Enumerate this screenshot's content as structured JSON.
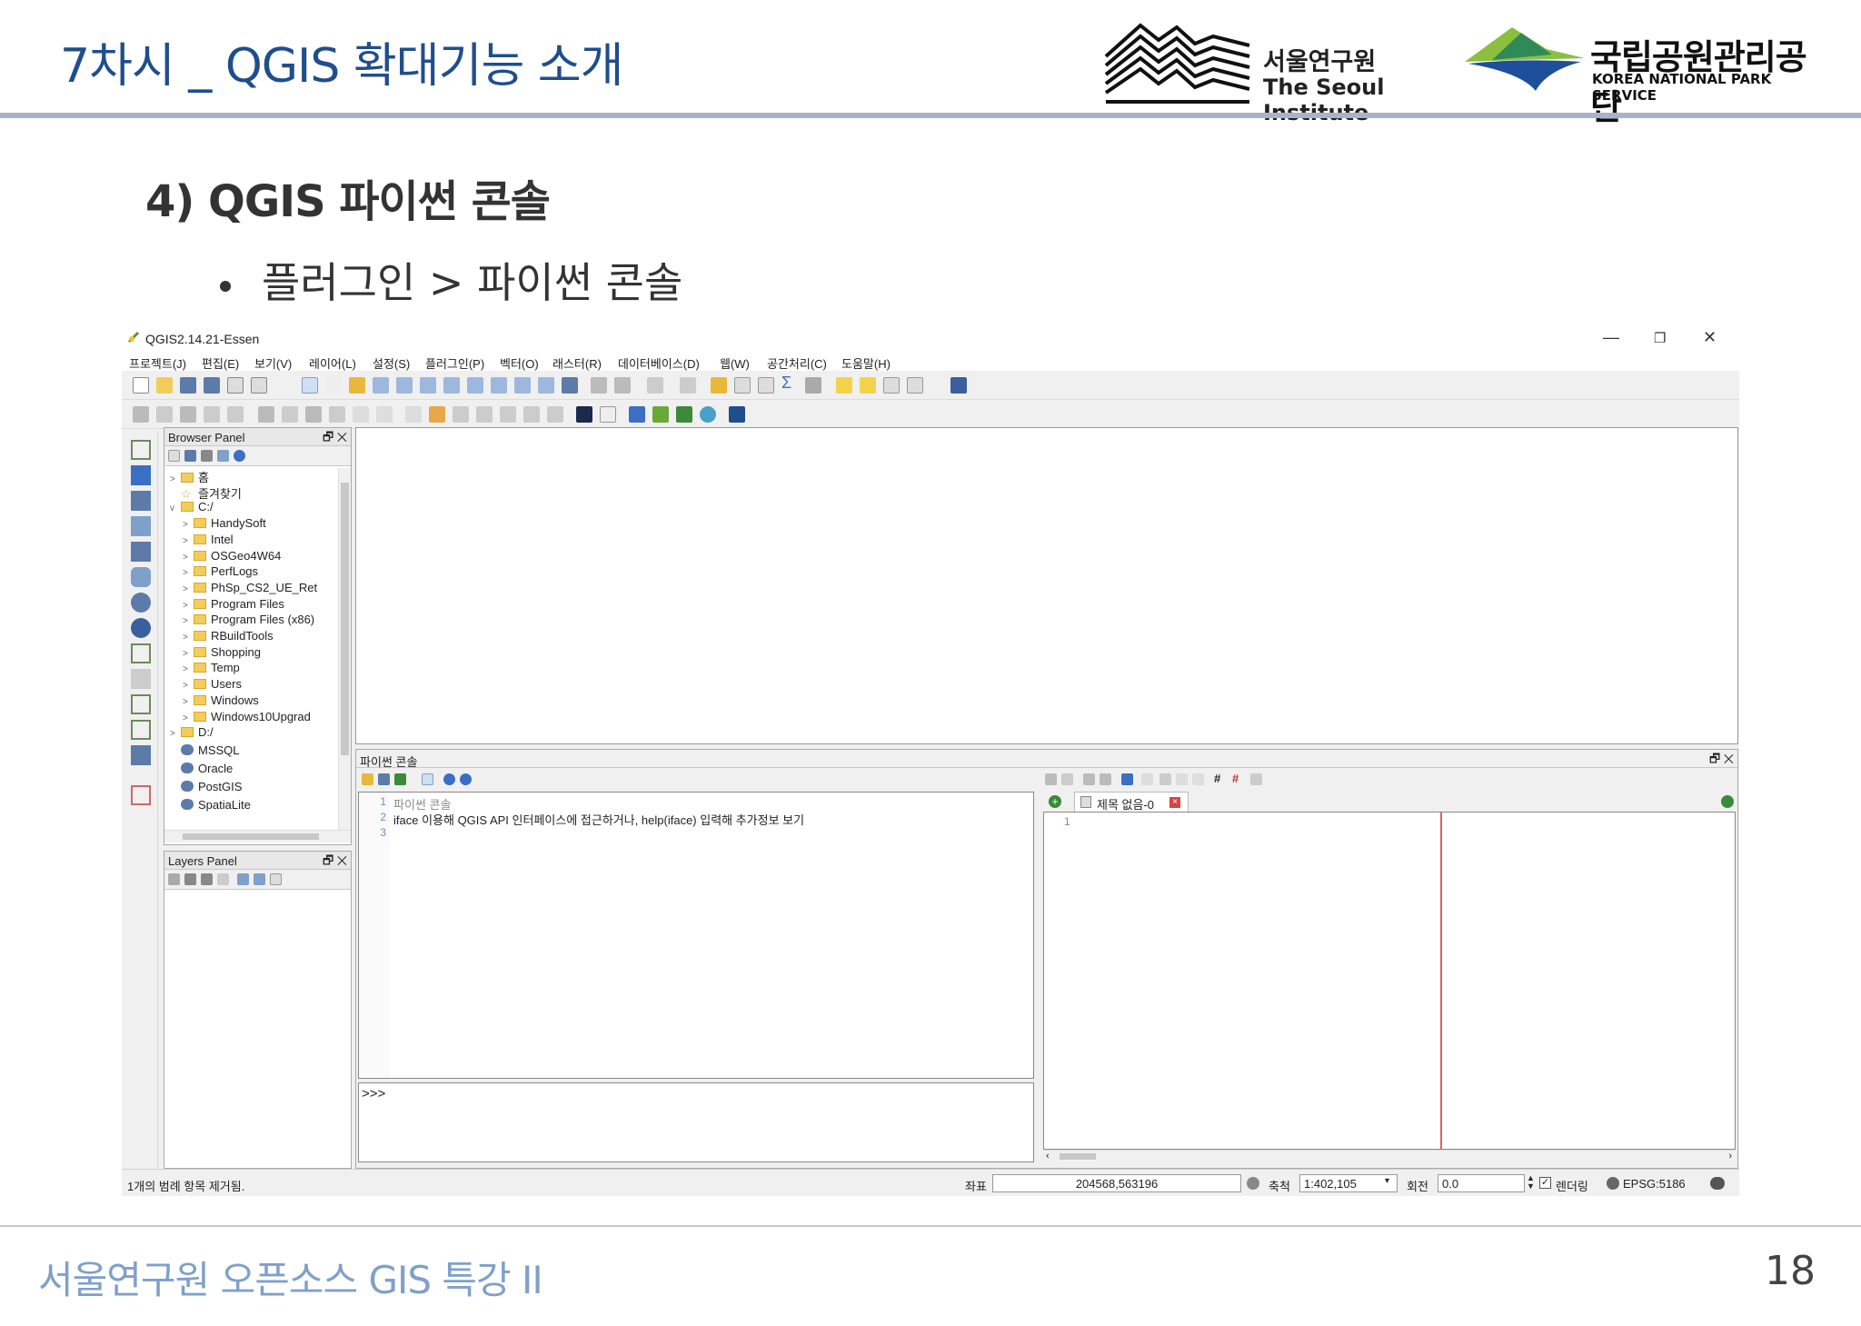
{
  "slide": {
    "title": "7차시 _ QGIS 확대기능 소개",
    "section": "4) QGIS 파이썬 콘솔",
    "bullet": "플러그인 > 파이썬 콘솔",
    "footer": "서울연구원 오픈소스 GIS 특강 II",
    "page_number": "18"
  },
  "logos": {
    "seoul_ko": "서울연구원",
    "seoul_en": "The Seoul Institute",
    "park_ko": "국립공원관리공단",
    "park_en": "KOREA NATIONAL PARK SERVICE"
  },
  "window": {
    "title": "QGIS2.14.21-Essen",
    "minimize": "—",
    "restore": "❐",
    "close": "✕"
  },
  "menu": [
    "프로젝트(J)",
    "편집(E)",
    "보기(V)",
    "레이어(L)",
    "설정(S)",
    "플러그인(P)",
    "벡터(O)",
    "래스터(R)",
    "데이터베이스(D)",
    "웹(W)",
    "공간처리(C)",
    "도움말(H)"
  ],
  "browser_panel": {
    "title": "Browser Panel",
    "controls": "🗗 ✕",
    "items": [
      {
        "label": "홈",
        "type": "folder",
        "arrow": ">"
      },
      {
        "label": "즐겨찾기",
        "type": "star",
        "arrow": ""
      },
      {
        "label": "C:/",
        "type": "folder",
        "arrow": "v"
      },
      {
        "label": "HandySoft",
        "type": "folder",
        "arrow": ">"
      },
      {
        "label": "Intel",
        "type": "folder",
        "arrow": ">"
      },
      {
        "label": "OSGeo4W64",
        "type": "folder",
        "arrow": ">"
      },
      {
        "label": "PerfLogs",
        "type": "folder",
        "arrow": ">"
      },
      {
        "label": "PhSp_CS2_UE_Ret",
        "type": "folder",
        "arrow": ">"
      },
      {
        "label": "Program Files",
        "type": "folder",
        "arrow": ">"
      },
      {
        "label": "Program Files (x86)",
        "type": "folder",
        "arrow": ">"
      },
      {
        "label": "RBuildTools",
        "type": "folder",
        "arrow": ">"
      },
      {
        "label": "Shopping",
        "type": "folder",
        "arrow": ">"
      },
      {
        "label": "Temp",
        "type": "folder",
        "arrow": ">"
      },
      {
        "label": "Users",
        "type": "folder",
        "arrow": ">"
      },
      {
        "label": "Windows",
        "type": "folder",
        "arrow": ">"
      },
      {
        "label": "Windows10Upgrad",
        "type": "folder",
        "arrow": ">"
      },
      {
        "label": "D:/",
        "type": "folder",
        "arrow": ">"
      },
      {
        "label": "MSSQL",
        "type": "db",
        "arrow": ""
      },
      {
        "label": "Oracle",
        "type": "db",
        "arrow": ""
      },
      {
        "label": "PostGIS",
        "type": "db",
        "arrow": ""
      },
      {
        "label": "SpatiaLite",
        "type": "db",
        "arrow": ""
      }
    ]
  },
  "layers_panel": {
    "title": "Layers Panel",
    "controls": "🗗 ✕"
  },
  "python_console": {
    "title": "파이썬 콘솔",
    "controls": "🗗 ✕",
    "lines": [
      {
        "num": "1",
        "text": "파이썬 콘솔"
      },
      {
        "num": "2",
        "text": "iface 이용해 QGIS API 인터페이스에 접근하거나, help(iface) 입력해 추가정보 보기"
      },
      {
        "num": "3",
        "text": ""
      }
    ],
    "prompt": ">>>",
    "editor_tab": "제목 없음-0",
    "editor_line": "1"
  },
  "status": {
    "message": "1개의 범례 항목 제거됨.",
    "coord_label": "좌표",
    "coord_value": "204568,563196",
    "scale_label": "축척",
    "scale_value": "1:402,105",
    "rotation_label": "회전",
    "rotation_value": "0.0",
    "render_label": "렌더링",
    "crs": "EPSG:5186"
  }
}
